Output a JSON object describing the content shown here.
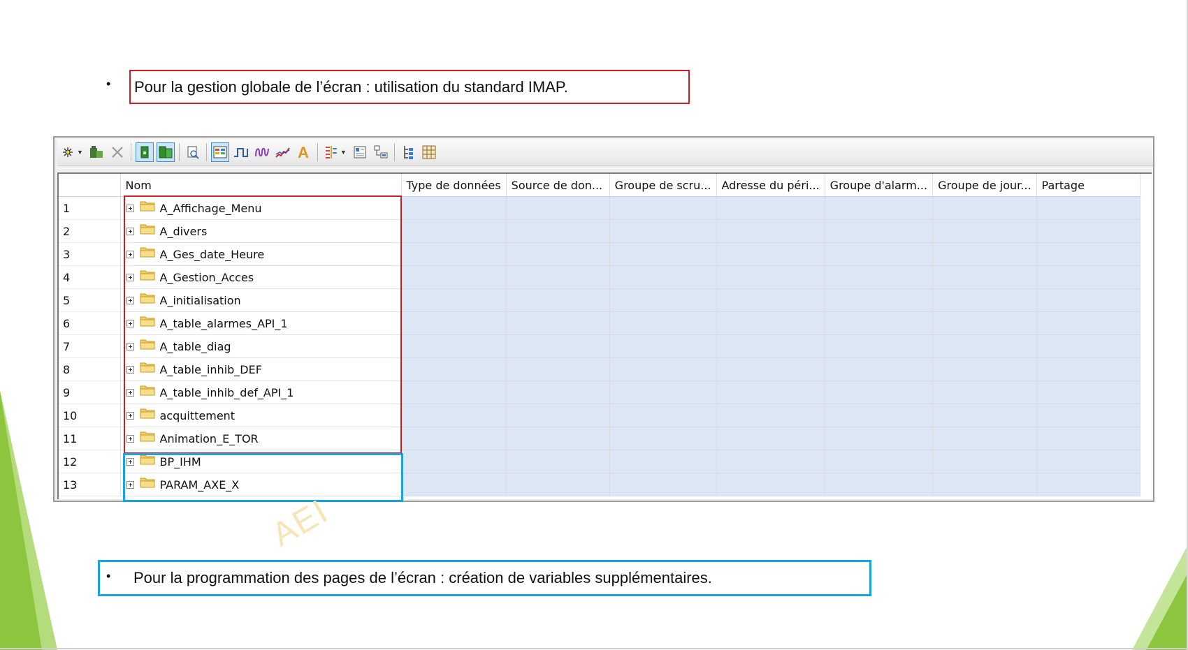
{
  "bullets": {
    "top": "Pour la gestion globale de l’écran : utilisation du standard IMAP.",
    "bottom": "Pour la programmation des pages de l’écran : création de variables supplémentaires.",
    "marker": "•"
  },
  "colors": {
    "red_frame": "#d01c24",
    "blue_frame": "#1ba3de",
    "green_decor": "#8cc63f",
    "cell_fill": "#dce6f4"
  },
  "toolbar": {
    "icons": [
      "new-variable-icon",
      "dropdown-arrow-icon",
      "module-icon",
      "delete-icon",
      "view-green-icon",
      "view-green-multi-icon",
      "preview-icon",
      "table-view-icon",
      "digital-signal-icon",
      "analog-signal-icon",
      "trend-icon",
      "text-icon",
      "tree-columns-icon",
      "dropdown-arrow-icon",
      "properties-icon",
      "hierarchy-icon",
      "tree-icon",
      "grid-icon"
    ]
  },
  "watermark": "AEI",
  "table": {
    "columns": [
      "",
      "Nom",
      "Type de données",
      "Source de don...",
      "Groupe de scru...",
      "Adresse du péri...",
      "Groupe d'alarm...",
      "Groupe de jour...",
      "Partage"
    ],
    "rows": [
      {
        "num": "1",
        "name": "A_Affichage_Menu"
      },
      {
        "num": "2",
        "name": "A_divers"
      },
      {
        "num": "3",
        "name": "A_Ges_date_Heure"
      },
      {
        "num": "4",
        "name": "A_Gestion_Acces"
      },
      {
        "num": "5",
        "name": "A_initialisation"
      },
      {
        "num": "6",
        "name": "A_table_alarmes_API_1"
      },
      {
        "num": "7",
        "name": "A_table_diag"
      },
      {
        "num": "8",
        "name": "A_table_inhib_DEF"
      },
      {
        "num": "9",
        "name": "A_table_inhib_def_API_1"
      },
      {
        "num": "10",
        "name": "acquittement"
      },
      {
        "num": "11",
        "name": "Animation_E_TOR"
      },
      {
        "num": "12",
        "name": "BP_IHM"
      },
      {
        "num": "13",
        "name": "PARAM_AXE_X"
      }
    ]
  }
}
